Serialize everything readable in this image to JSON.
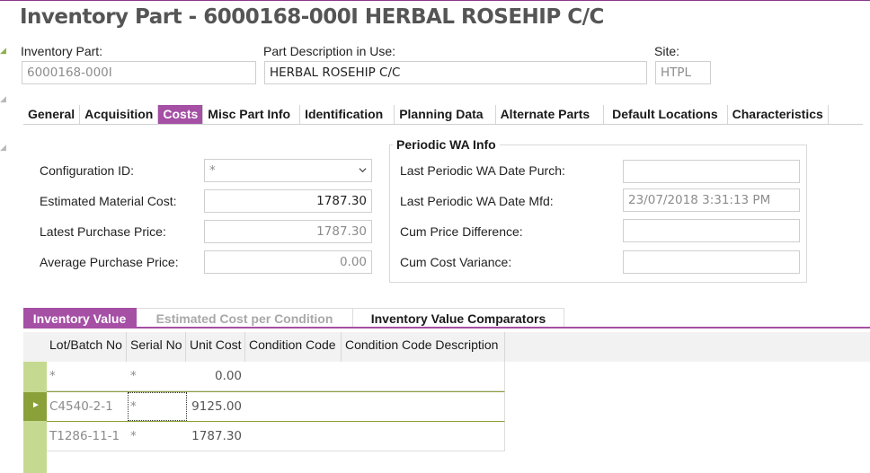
{
  "page": {
    "title": "Inventory Part - 6000168-000I HERBAL ROSEHIP C/C"
  },
  "header": {
    "inventory_part_label": "Inventory Part:",
    "inventory_part_value": "6000168-000I",
    "part_description_label": "Part Description in Use:",
    "part_description_value": "HERBAL ROSEHIP C/C",
    "site_label": "Site:",
    "site_value": "HTPL"
  },
  "tabs": [
    {
      "label": "General"
    },
    {
      "label": "Acquisition"
    },
    {
      "label": "Costs",
      "active": true
    },
    {
      "label": "Misc Part Info"
    },
    {
      "label": "Identification"
    },
    {
      "label": "Planning Data"
    },
    {
      "label": "Alternate Parts"
    },
    {
      "label": "Default Locations"
    },
    {
      "label": "Characteristics"
    }
  ],
  "costs": {
    "configuration_id_label": "Configuration ID:",
    "configuration_id_value": "*",
    "estimated_material_cost_label": "Estimated Material Cost:",
    "estimated_material_cost_value": "1787.30",
    "latest_purchase_price_label": "Latest Purchase Price:",
    "latest_purchase_price_value": "1787.30",
    "average_purchase_price_label": "Average Purchase Price:",
    "average_purchase_price_value": "0.00"
  },
  "periodic_wa": {
    "title": "Periodic WA Info",
    "last_date_purch_label": "Last Periodic WA Date Purch:",
    "last_date_purch_value": "",
    "last_date_mfd_label": "Last Periodic WA Date Mfd:",
    "last_date_mfd_value": "23/07/2018 3:31:13 PM",
    "cum_price_difference_label": "Cum Price Difference:",
    "cum_price_difference_value": "",
    "cum_cost_variance_label": "Cum Cost Variance:",
    "cum_cost_variance_value": ""
  },
  "subtabs": [
    {
      "label": "Inventory Value",
      "active": true
    },
    {
      "label": "Estimated Cost per Condition",
      "disabled": true
    },
    {
      "label": "Inventory Value Comparators"
    }
  ],
  "grid": {
    "columns": [
      "Lot/Batch No",
      "Serial No",
      "Unit Cost",
      "Condition Code",
      "Condition Code Description"
    ],
    "rows": [
      {
        "lot": "*",
        "serial": "*",
        "unit_cost": "0.00"
      },
      {
        "lot": "C4540-2-1",
        "serial": "*",
        "unit_cost": "9125.00",
        "selected": true
      },
      {
        "lot": "T1286-11-1",
        "serial": "*",
        "unit_cost": "1787.30"
      }
    ]
  },
  "colors": {
    "accent": "#a54fa5",
    "selection": "#8aa038",
    "selection_col": "#c5da90"
  }
}
